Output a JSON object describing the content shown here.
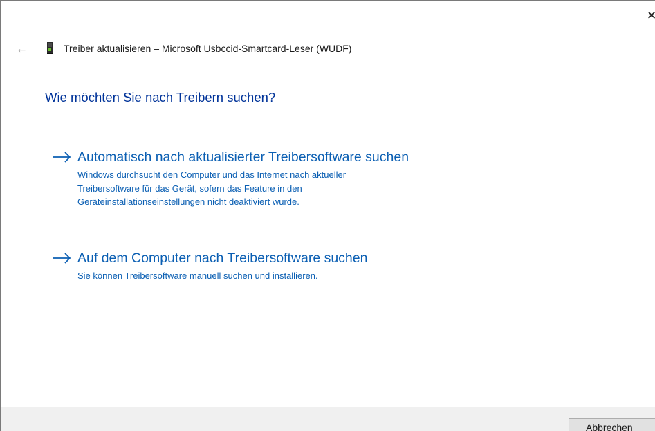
{
  "window": {
    "title": "Treiber aktualisieren – Microsoft Usbccid-Smartcard-Leser (WUDF)",
    "close_glyph": "✕",
    "back_glyph": "←"
  },
  "main": {
    "heading": "Wie möchten Sie nach Treibern suchen?",
    "options": [
      {
        "title": "Automatisch nach aktualisierter Treibersoftware suchen",
        "description_lines": [
          "Windows durchsucht den Computer und das Internet nach aktueller",
          "Treibersoftware für das Gerät, sofern das Feature in den",
          "Geräteinstallationseinstellungen nicht deaktiviert wurde."
        ]
      },
      {
        "title": "Auf dem Computer nach Treibersoftware suchen",
        "description_lines": [
          "Sie können Treibersoftware manuell suchen und installieren."
        ]
      }
    ]
  },
  "footer": {
    "cancel_label": "Abbrechen"
  },
  "colors": {
    "heading": "#003399",
    "link": "#0b5fb3",
    "footer_bg": "#f0f0f0"
  },
  "icons": {
    "back": "back-arrow-icon",
    "device": "smartcard-reader-device-icon",
    "option_arrow": "right-arrow-icon",
    "close": "close-icon"
  }
}
